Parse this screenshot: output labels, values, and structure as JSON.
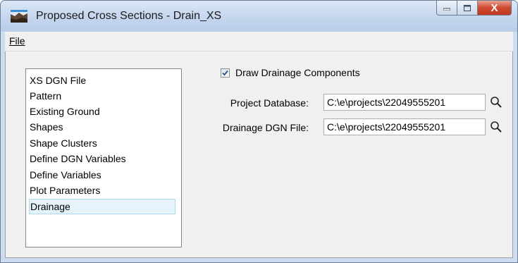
{
  "window": {
    "title": "Proposed Cross Sections - Drain_XS",
    "close_glyph": "X"
  },
  "menu": {
    "file_label": "File"
  },
  "sidebar": {
    "items": [
      {
        "label": "XS DGN File"
      },
      {
        "label": "Pattern"
      },
      {
        "label": "Existing Ground"
      },
      {
        "label": "Shapes"
      },
      {
        "label": "Shape Clusters"
      },
      {
        "label": "Define DGN Variables"
      },
      {
        "label": "Define Variables"
      },
      {
        "label": "Plot Parameters"
      },
      {
        "label": "Drainage"
      }
    ],
    "selected": "Drainage"
  },
  "drainage": {
    "draw_components": {
      "label": "Draw Drainage Components",
      "checked": true
    },
    "project_database": {
      "label": "Project Database:",
      "value": "C:\\e\\projects\\22049555201"
    },
    "drainage_dgn_file": {
      "label": "Drainage DGN File:",
      "value": "C:\\e\\projects\\22049555201"
    }
  },
  "icons": {
    "app": "cross-section-app-icon",
    "minimize": "minimize-icon",
    "maximize": "maximize-icon",
    "close": "close-icon",
    "browse": "magnifier-icon"
  }
}
